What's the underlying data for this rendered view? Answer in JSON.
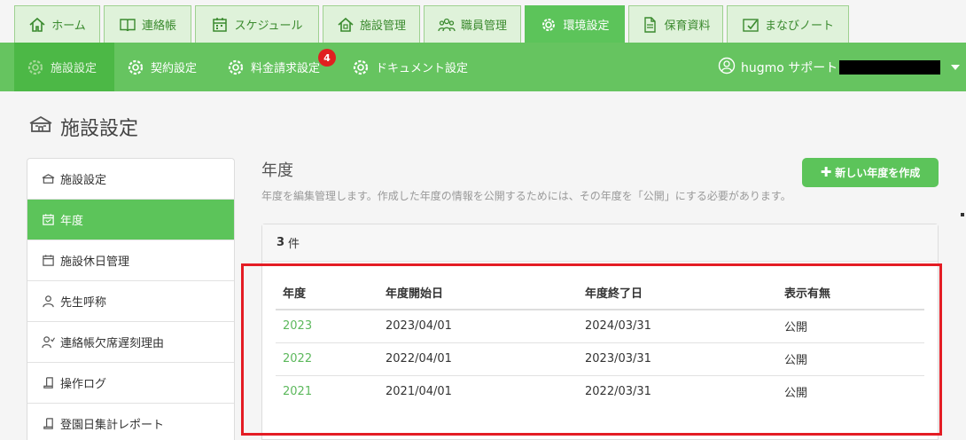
{
  "tabs": [
    {
      "label": "ホーム",
      "icon": "home-icon"
    },
    {
      "label": "連絡帳",
      "icon": "book-icon"
    },
    {
      "label": "スケジュール",
      "icon": "calendar-icon"
    },
    {
      "label": "施設管理",
      "icon": "building-icon"
    },
    {
      "label": "職員管理",
      "icon": "staff-icon"
    },
    {
      "label": "環境設定",
      "icon": "gear-icon"
    },
    {
      "label": "保育資料",
      "icon": "document-icon"
    },
    {
      "label": "まなびノート",
      "icon": "note-icon"
    }
  ],
  "subnav": {
    "items": [
      {
        "label": "施設設定",
        "icon": "gear-icon"
      },
      {
        "label": "契約設定",
        "icon": "gear-icon"
      },
      {
        "label": "料金請求設定",
        "icon": "gear-icon"
      },
      {
        "label": "ドキュメント設定",
        "icon": "gear-icon"
      }
    ],
    "badge": "4",
    "user_name": "hugmo サポート"
  },
  "page_title": "施設設定",
  "sidebar": {
    "items": [
      {
        "label": "施設設定"
      },
      {
        "label": "年度"
      },
      {
        "label": "施設休日管理"
      },
      {
        "label": "先生呼称"
      },
      {
        "label": "連絡帳欠席遅刻理由"
      },
      {
        "label": "操作ログ"
      },
      {
        "label": "登園日集計レポート"
      }
    ]
  },
  "main": {
    "title": "年度",
    "description": "年度を編集管理します。作成した年度の情報を公開するためには、その年度を「公開」にする必要があります。",
    "new_button": "新しい年度を作成",
    "count": "3",
    "count_unit": "件",
    "table": {
      "headers": [
        "年度",
        "年度開始日",
        "年度終了日",
        "表示有無"
      ],
      "rows": [
        {
          "year": "2023",
          "start": "2023/04/01",
          "end": "2024/03/31",
          "status": "公開"
        },
        {
          "year": "2022",
          "start": "2022/04/01",
          "end": "2023/03/31",
          "status": "公開"
        },
        {
          "year": "2021",
          "start": "2021/04/01",
          "end": "2022/03/31",
          "status": "公開"
        }
      ]
    }
  },
  "colors": {
    "accent": "#5cc45a",
    "highlight": "#e41c24",
    "link": "#5cb85c"
  }
}
